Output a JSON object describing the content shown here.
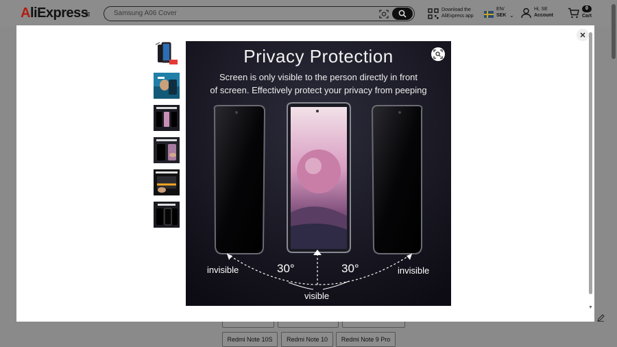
{
  "header": {
    "logo": "AliExpress",
    "logo_first": "A",
    "logo_rest": "liExpress",
    "menu_icon": "hamburger-icon",
    "search_placeholder": "Samsung A06 Cover",
    "camera_icon": "camera-search-icon",
    "search_icon": "search-icon",
    "app_download_line1": "Download the",
    "app_download_line2": "AliExpress app",
    "lang_code": "EN/",
    "currency": "SEK",
    "greeting": "Hi, SE",
    "account_label": "Account",
    "cart_count": "0",
    "cart_label": "Cart"
  },
  "modal": {
    "close_icon": "close-icon",
    "zoom_icon": "zoom-icon",
    "thumbnails": [
      {
        "name": "thumbnail-1"
      },
      {
        "name": "thumbnail-2"
      },
      {
        "name": "thumbnail-3"
      },
      {
        "name": "thumbnail-4"
      },
      {
        "name": "thumbnail-5"
      },
      {
        "name": "thumbnail-6"
      }
    ],
    "image": {
      "title": "Privacy Protection",
      "subtitle_line1": "Screen is only visible to the person directly in front",
      "subtitle_line2": "of screen. Effectively protect your privacy from peeping",
      "label_invisible_left": "invisible",
      "label_angle_left": "30°",
      "label_angle_right": "30°",
      "label_invisible_right": "invisible",
      "label_visible": "visible"
    }
  },
  "variants": {
    "chips": [
      "Redmi Note 10S",
      "Redmi Note 10",
      "Redmi Note 9 Pro"
    ]
  },
  "colors": {
    "overlay": "#8a8a8a",
    "modal_bg": "#ffffff",
    "logo_accent": "#b31b12",
    "search_button": "#0f0f0f"
  }
}
